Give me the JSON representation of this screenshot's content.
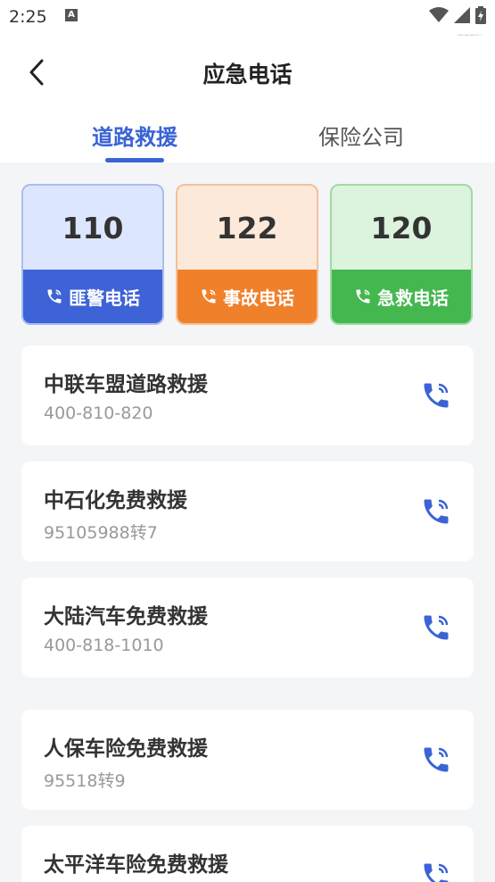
{
  "status_bar": {
    "time": "2:25",
    "app_badge": "A",
    "watermark": "968h"
  },
  "header": {
    "title": "应急电话"
  },
  "tabs": [
    {
      "label": "道路救援",
      "active": true
    },
    {
      "label": "保险公司",
      "active": false
    }
  ],
  "hotlines": [
    {
      "number": "110",
      "label": "匪警电话",
      "color": "#3e63d6"
    },
    {
      "number": "122",
      "label": "事故电话",
      "color": "#f0802a"
    },
    {
      "number": "120",
      "label": "急救电话",
      "color": "#44b74f"
    }
  ],
  "contacts": [
    {
      "name": "中联车盟道路救援",
      "phone": "400-810-820"
    },
    {
      "name": "中石化免费救援",
      "phone": "95105988转7"
    },
    {
      "name": "大陆汽车免费救援",
      "phone": "400-818-1010"
    },
    {
      "name": "人保车险免费救援",
      "phone": "95518转9"
    },
    {
      "name": "太平洋车险免费救援",
      "phone": ""
    }
  ],
  "colors": {
    "accent": "#3a63d6",
    "call_icon": "#3a63d6"
  }
}
